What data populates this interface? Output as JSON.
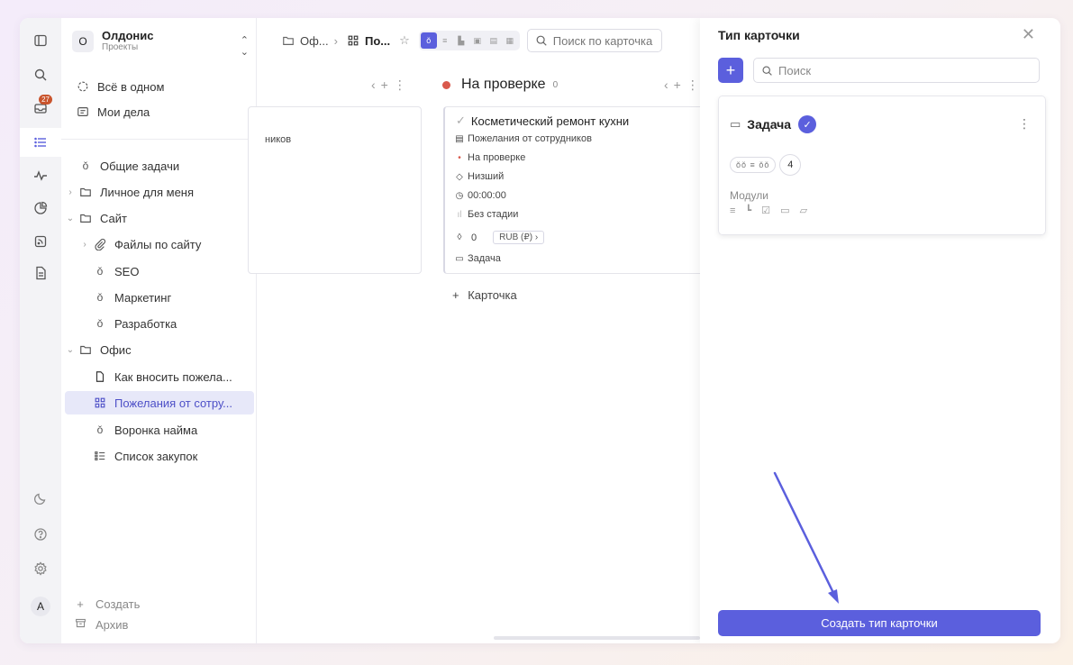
{
  "workspace": {
    "avatar_letter": "О",
    "name": "Олдонис",
    "subtitle": "Проекты"
  },
  "rail": {
    "inbox_badge": "27",
    "user_initial": "A"
  },
  "sidebar": {
    "top_items": [
      {
        "label": "Всё в одном",
        "icon": "circle-dashed-icon"
      },
      {
        "label": "Мои дела",
        "icon": "document-icon"
      }
    ],
    "items": [
      {
        "label": "Общие задачи",
        "icon": "kanban-icon"
      },
      {
        "label": "Личное для меня",
        "icon": "folder-icon"
      },
      {
        "label": "Сайт",
        "icon": "folder-icon"
      },
      {
        "label": "Файлы по сайту",
        "icon": "paperclip-icon"
      },
      {
        "label": "SEO",
        "icon": "kanban-icon"
      },
      {
        "label": "Маркетинг",
        "icon": "kanban-icon"
      },
      {
        "label": "Разработка",
        "icon": "kanban-icon"
      },
      {
        "label": "Офис",
        "icon": "folder-icon"
      },
      {
        "label": "Как вносить пожела...",
        "icon": "page-icon"
      },
      {
        "label": "Пожелания от сотру...",
        "icon": "grid-icon"
      },
      {
        "label": "Воронка найма",
        "icon": "kanban-icon"
      },
      {
        "label": "Список закупок",
        "icon": "list-icon"
      }
    ],
    "create_label": "Создать",
    "archive_label": "Архив"
  },
  "board": {
    "breadcrumb_folder": "Оф...",
    "breadcrumb_current": "По...",
    "search_placeholder": "Поиск по карточка",
    "partial_card_text": "ников",
    "column": {
      "title": "На проверке",
      "count": "0"
    },
    "card": {
      "title": "Косметический ремонт кухни",
      "board": "Пожелания от сотрудников",
      "status": "На проверке",
      "priority": "Низший",
      "time": "00:00:00",
      "stage": "Без стадии",
      "amount": "0",
      "currency": "RUB (₽)",
      "type": "Задача"
    },
    "add_card_label": "Карточка"
  },
  "panel": {
    "title": "Тип карточки",
    "search_placeholder": "Поиск",
    "type_card": {
      "name": "Задача",
      "views_count": "4",
      "modules_label": "Модули"
    },
    "create_button": "Создать тип карточки",
    "accent_color": "#5b5fdd",
    "arrow_color": "#5b5fdd"
  }
}
